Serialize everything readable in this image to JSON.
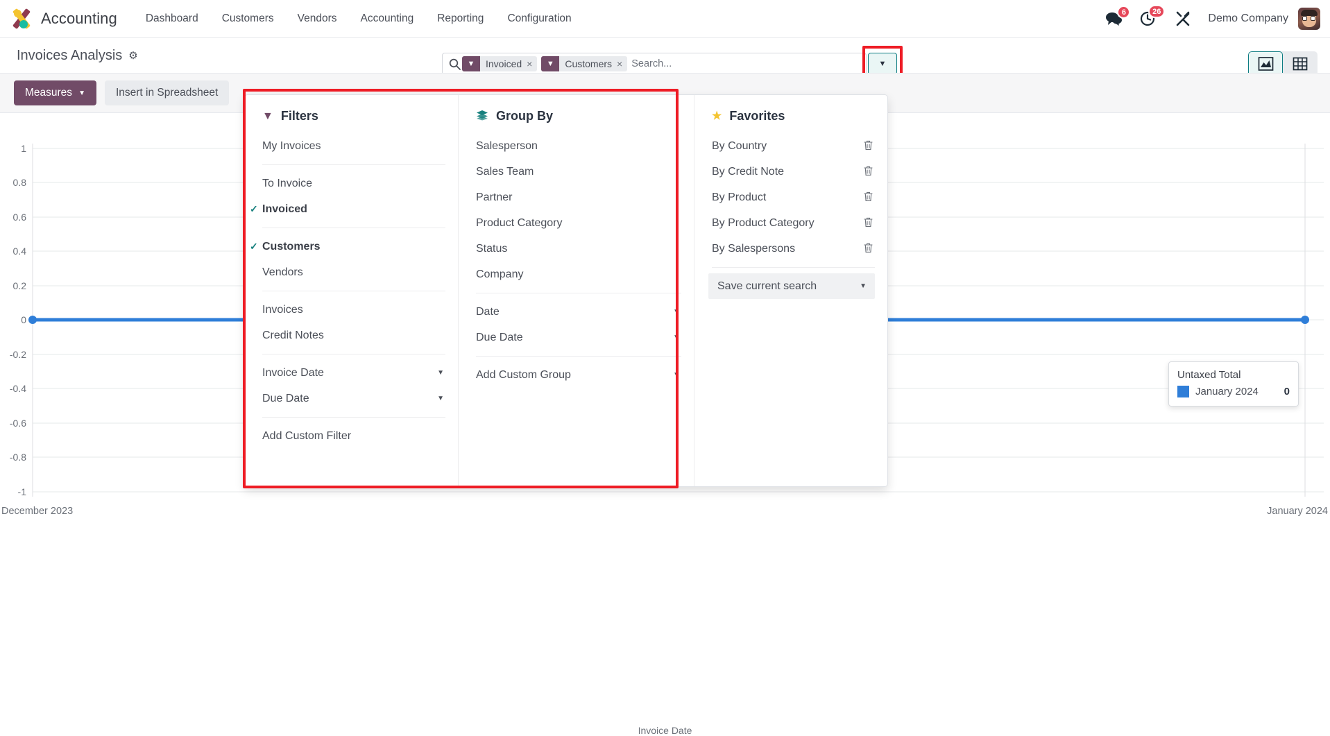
{
  "navbar": {
    "brand": "Accounting",
    "brand_logo_icon": "odoo-logo-icon",
    "menu": [
      {
        "label": "Dashboard"
      },
      {
        "label": "Customers"
      },
      {
        "label": "Vendors"
      },
      {
        "label": "Accounting"
      },
      {
        "label": "Reporting"
      },
      {
        "label": "Configuration"
      }
    ],
    "messages_icon": "chat-bubble-icon",
    "messages_count": "6",
    "activities_icon": "clock-icon",
    "activities_count": "26",
    "debug_icon": "tools-icon",
    "company": "Demo Company",
    "avatar_icon": "user-avatar-icon"
  },
  "control_panel": {
    "page_title": "Invoices Analysis",
    "gear_icon": "gear-icon",
    "search": {
      "search_icon": "search-icon",
      "placeholder": "Search...",
      "value": "",
      "facets": [
        {
          "icon": "filter-funnel-icon",
          "label": "Invoiced",
          "remove": "×"
        },
        {
          "icon": "filter-funnel-icon",
          "label": "Customers",
          "remove": "×"
        }
      ],
      "toggle_icon": "chevron-down-icon"
    },
    "view_switcher": [
      {
        "icon": "graph-chart-icon",
        "active": true
      },
      {
        "icon": "pivot-table-icon",
        "active": false
      }
    ]
  },
  "toolbar": {
    "measures_label": "Measures",
    "measures_caret": "▼",
    "insert_spreadsheet_label": "Insert in Spreadsheet"
  },
  "search_panel": {
    "filters": {
      "title": "Filters",
      "icon": "filter-funnel-icon",
      "groups": [
        [
          {
            "label": "My Invoices",
            "selected": false
          }
        ],
        [
          {
            "label": "To Invoice",
            "selected": false
          },
          {
            "label": "Invoiced",
            "selected": true
          }
        ],
        [
          {
            "label": "Customers",
            "selected": true
          },
          {
            "label": "Vendors",
            "selected": false
          }
        ],
        [
          {
            "label": "Invoices",
            "selected": false
          },
          {
            "label": "Credit Notes",
            "selected": false
          }
        ],
        [
          {
            "label": "Invoice Date",
            "selected": false,
            "arrow": "▼"
          },
          {
            "label": "Due Date",
            "selected": false,
            "arrow": "▼"
          }
        ],
        [
          {
            "label": "Add Custom Filter",
            "selected": false
          }
        ]
      ]
    },
    "group_by": {
      "title": "Group By",
      "icon": "layers-icon",
      "groups": [
        [
          {
            "label": "Salesperson"
          },
          {
            "label": "Sales Team"
          },
          {
            "label": "Partner"
          },
          {
            "label": "Product Category"
          },
          {
            "label": "Status"
          },
          {
            "label": "Company"
          }
        ],
        [
          {
            "label": "Date",
            "arrow": "▼"
          },
          {
            "label": "Due Date",
            "arrow": "▼"
          }
        ],
        [
          {
            "label": "Add Custom Group",
            "arrow": "▼"
          }
        ]
      ]
    },
    "favorites": {
      "title": "Favorites",
      "icon": "star-icon",
      "items": [
        {
          "label": "By Country",
          "trash": "🗑"
        },
        {
          "label": "By Credit Note",
          "trash": "🗑"
        },
        {
          "label": "By Product",
          "trash": "🗑"
        },
        {
          "label": "By Product Category",
          "trash": "🗑"
        },
        {
          "label": "By Salespersons",
          "trash": "🗑"
        }
      ],
      "save_label": "Save current search",
      "save_arrow": "▼"
    }
  },
  "tooltip": {
    "title": "Untaxed Total",
    "series_label": "January 2024",
    "value": "0",
    "swatch_color": "#2f7ed8"
  },
  "chart_data": {
    "type": "line",
    "title": "",
    "xlabel": "Invoice Date",
    "ylabel": "",
    "x": [
      "December 2023",
      "January 2024"
    ],
    "tick_labels_x": [
      "December 2023",
      "January 2024"
    ],
    "tick_labels_y": [
      "1",
      "0.8",
      "0.6",
      "0.4",
      "0.2",
      "0",
      "-0.2",
      "-0.4",
      "-0.6",
      "-0.8",
      "-1"
    ],
    "ylim": [
      -1,
      1
    ],
    "grid": true,
    "legend": "none",
    "series": [
      {
        "name": "Untaxed Total",
        "color": "#2f7ed8",
        "values": [
          0,
          0
        ]
      }
    ]
  },
  "highlights": {
    "search_toggle_box_color": "#ee1c25",
    "filters_panel_box_color": "#ee1c25"
  }
}
